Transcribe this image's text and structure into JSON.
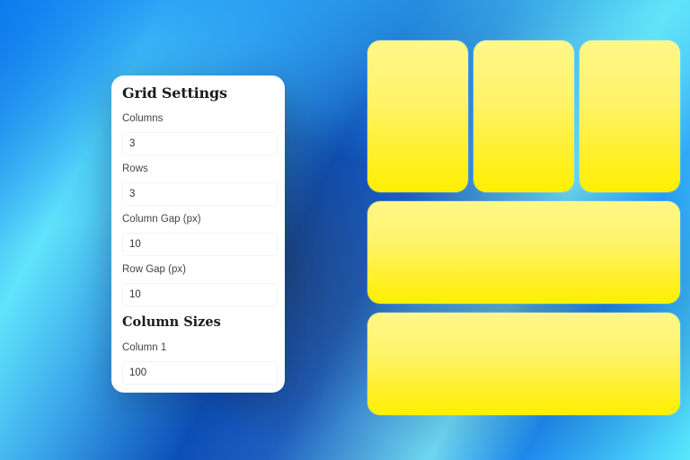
{
  "settings_panel": {
    "title": "Grid Settings",
    "fields": [
      {
        "label": "Columns",
        "value": "3"
      },
      {
        "label": "Rows",
        "value": "3"
      },
      {
        "label": "Column Gap (px)",
        "value": "10"
      },
      {
        "label": "Row Gap (px)",
        "value": "10"
      }
    ],
    "column_sizes": {
      "title": "Column Sizes",
      "fields": [
        {
          "label": "Column 1",
          "value": "100"
        }
      ]
    }
  },
  "grid_preview": {
    "cell_color_top": "#fff78a",
    "cell_color_bottom": "#fff000",
    "cells": [
      {
        "name": "cell-1"
      },
      {
        "name": "cell-2"
      },
      {
        "name": "cell-3"
      },
      {
        "name": "cell-4"
      },
      {
        "name": "cell-5"
      }
    ]
  }
}
